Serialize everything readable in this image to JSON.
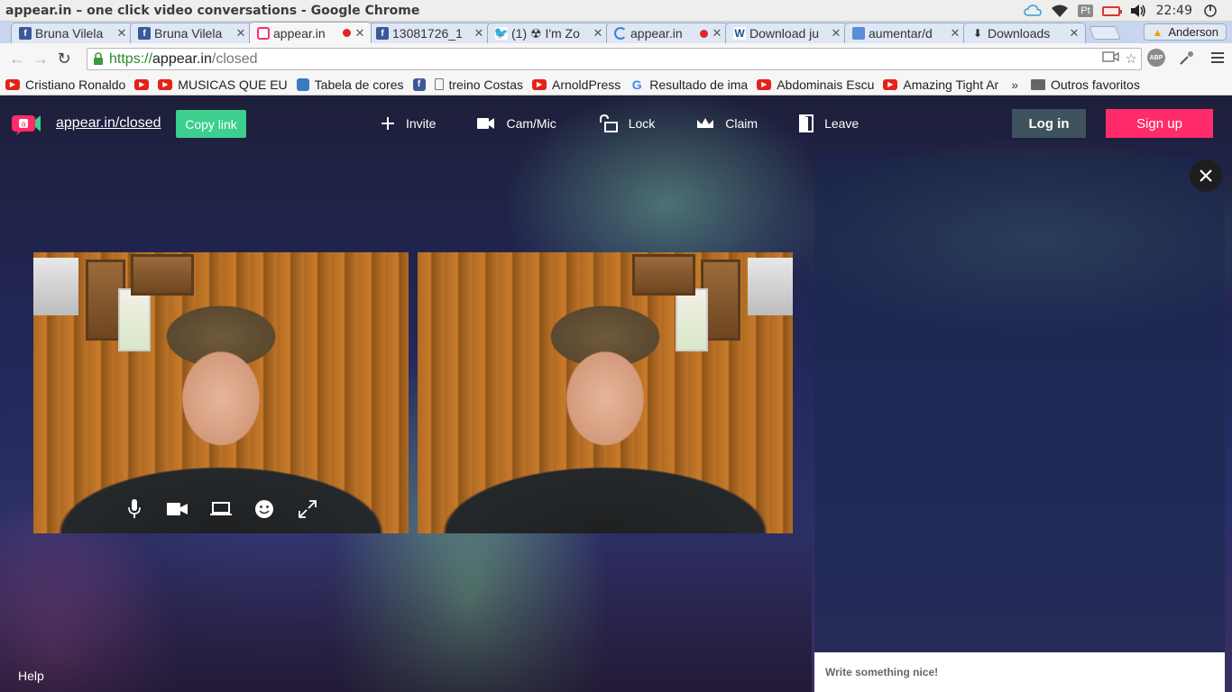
{
  "os": {
    "window_title": "appear.in – one click video conversations - Google Chrome",
    "language": "Pt",
    "clock": "22:49"
  },
  "tabs": [
    {
      "title": "Bruna Vilela",
      "favicon": "facebook-icon",
      "recording": false,
      "active": false
    },
    {
      "title": "Bruna Vilela",
      "favicon": "facebook-icon",
      "recording": false,
      "active": false
    },
    {
      "title": "appear.in",
      "favicon": "appear-in-icon",
      "recording": true,
      "active": true
    },
    {
      "title": "13081726_1",
      "favicon": "facebook-icon",
      "recording": false,
      "active": false
    },
    {
      "title": "(1) ☢ I'm Zo",
      "favicon": "twitter-icon",
      "recording": false,
      "active": false
    },
    {
      "title": "appear.in",
      "favicon": "loading-icon",
      "recording": true,
      "active": false
    },
    {
      "title": "Download ju",
      "favicon": "download-site-icon",
      "recording": false,
      "active": false
    },
    {
      "title": "aumentar/d",
      "favicon": "cube-icon",
      "recording": false,
      "active": false
    },
    {
      "title": "Downloads",
      "favicon": "download-icon",
      "recording": false,
      "active": false
    }
  ],
  "profile": {
    "name": "Anderson"
  },
  "omnibox": {
    "scheme": "https://",
    "host": "appear.in",
    "path": "/closed"
  },
  "bookmarks": [
    {
      "label": "Cristiano Ronaldo",
      "icon": "youtube-icon"
    },
    {
      "label": "",
      "icon": "youtube-icon"
    },
    {
      "label": "MUSICAS QUE EU",
      "icon": "youtube-icon"
    },
    {
      "label": "Tabela de cores",
      "icon": "image-icon"
    },
    {
      "label": "",
      "icon": "facebook-icon"
    },
    {
      "label": "treino Costas",
      "icon": "page-icon"
    },
    {
      "label": "ArnoldPress",
      "icon": "youtube-icon"
    },
    {
      "label": "Resultado de ima",
      "icon": "google-icon"
    },
    {
      "label": "Abdominais Escu",
      "icon": "youtube-icon"
    },
    {
      "label": "Amazing Tight Ar",
      "icon": "youtube-icon"
    }
  ],
  "bookmarks_more": "»",
  "bookmarks_other": "Outros favoritos",
  "app": {
    "room_link": "appear.in/closed",
    "copy_link": "Copy link",
    "actions": {
      "invite": "Invite",
      "cam_mic": "Cam/Mic",
      "lock": "Lock",
      "claim": "Claim",
      "leave": "Leave"
    },
    "login": "Log in",
    "signup": "Sign up",
    "chat_placeholder": "Write something nice!",
    "help": "Help",
    "colors": {
      "accent_green": "#3ccf8e",
      "accent_pink": "#ff2b6a"
    }
  }
}
